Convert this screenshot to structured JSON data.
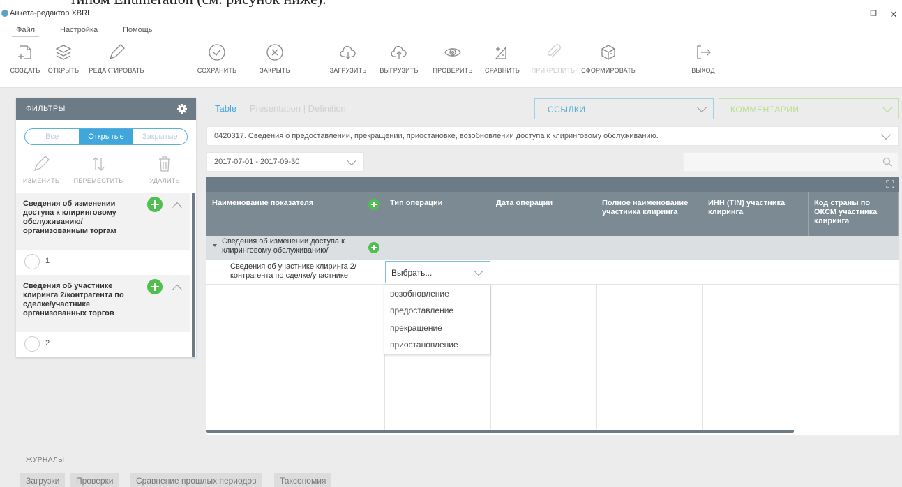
{
  "doc_fragment": "типом Enumeration (см. рисунок ниже).",
  "window": {
    "title": "Анкета-редактор XBRL",
    "minimize": "–",
    "maximize": "❐",
    "close": "✕"
  },
  "menu": [
    "Файл",
    "Настройка",
    "Помощь"
  ],
  "toolbar": [
    {
      "label": "СОЗДАТЬ",
      "icon": "create-icon"
    },
    {
      "label": "ОТКРЫТЬ",
      "icon": "layers-icon"
    },
    {
      "label": "РЕДАКТИРОВАТЬ",
      "icon": "pencil-icon"
    },
    {
      "label": "СОХРАНИТЬ",
      "icon": "check-circle-icon"
    },
    {
      "label": "ЗАКРЫТЬ",
      "icon": "x-circle-icon"
    },
    {
      "label": "ЗАГРУЗИТЬ",
      "icon": "cloud-download-icon"
    },
    {
      "label": "ВЫГРУЗИТЬ",
      "icon": "cloud-upload-icon"
    },
    {
      "label": "ПРОВЕРИТЬ",
      "icon": "eye-icon"
    },
    {
      "label": "СРАВНИТЬ",
      "icon": "compare-icon"
    },
    {
      "label": "ПРИКРЕПИТЬ",
      "icon": "paperclip-icon",
      "disabled": true
    },
    {
      "label": "СФОРМИРОВАТЬ",
      "icon": "cube-icon"
    },
    {
      "label": "ВЫХОД",
      "icon": "exit-icon"
    }
  ],
  "sidebar": {
    "title": "ФИЛЬТРЫ",
    "segments": [
      "Все",
      "Открытые",
      "Закрытые"
    ],
    "active_segment": "Открытые",
    "tools": [
      "ИЗМЕНИТЬ",
      "ПЕРЕМЕСТИТЬ",
      "УДАЛИТЬ"
    ],
    "nodes": [
      {
        "title": "Сведения об изменении доступа к клиринговому обслуживанию/ организованным торгам",
        "count": "1"
      },
      {
        "title": "Сведения об участнике клиринга 2/контрагента по сделке/участнике организованных торгов",
        "count": "2"
      }
    ]
  },
  "tabs": {
    "table": "Table",
    "rest": "Presentation | Definition"
  },
  "links_dropdown": "ССЫЛКИ",
  "comments_dropdown": "КОММЕНТАРИИ",
  "form_select": "0420317. Сведения о предоставлении, прекращении, приостановке, возобновлении доступа к клиринговому обслуживанию.",
  "period": "2017-07-01 - 2017-09-30",
  "grid": {
    "columns": [
      "Наименование показателя",
      "Тип операции",
      "Дата операции",
      "Полное наименование участника клиринга",
      "ИНН (TIN) участника клиринга",
      "Код страны по ОКСМ участника клиринга"
    ],
    "row1": "Сведения об изменении доступа к клиринговому обслуживанию/",
    "row2": "Сведения об участнике клиринга 2/ контрагента по сделке/участнике",
    "select_value": "Выбрать...",
    "options": [
      "возобновление",
      "предоставление",
      "прекращение",
      "приостановление"
    ]
  },
  "journals": {
    "title": "ЖУРНАЛЫ",
    "tabs": [
      "Загрузки",
      "Проверки",
      "Сравнение прошлых периодов",
      "Таксономия"
    ]
  }
}
